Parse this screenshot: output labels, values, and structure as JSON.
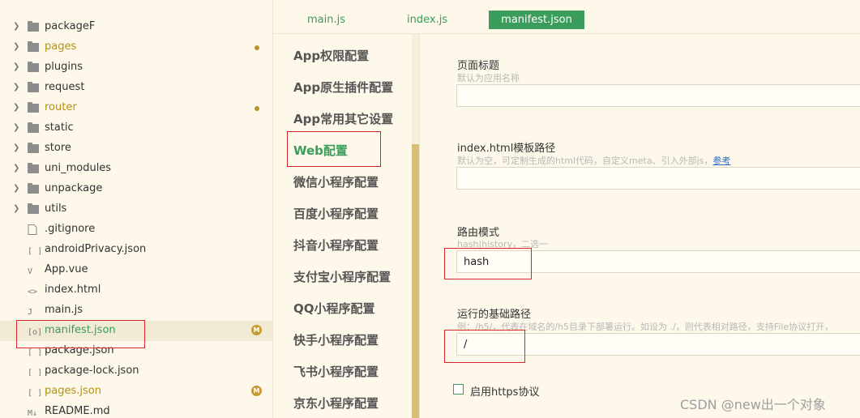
{
  "explorer": {
    "items": [
      {
        "label": "packageF",
        "kind": "folder",
        "status": ""
      },
      {
        "label": "pages",
        "kind": "folder",
        "status": "modified"
      },
      {
        "label": "plugins",
        "kind": "folder",
        "status": ""
      },
      {
        "label": "request",
        "kind": "folder",
        "status": ""
      },
      {
        "label": "router",
        "kind": "folder",
        "status": "modified"
      },
      {
        "label": "static",
        "kind": "folder",
        "status": ""
      },
      {
        "label": "store",
        "kind": "folder",
        "status": ""
      },
      {
        "label": "uni_modules",
        "kind": "folder",
        "status": ""
      },
      {
        "label": "unpackage",
        "kind": "folder",
        "status": ""
      },
      {
        "label": "utils",
        "kind": "folder",
        "status": ""
      },
      {
        "label": ".gitignore",
        "kind": "file",
        "glyph": "",
        "status": ""
      },
      {
        "label": "androidPrivacy.json",
        "kind": "file",
        "glyph": "[ ]",
        "status": ""
      },
      {
        "label": "App.vue",
        "kind": "file",
        "glyph": "V",
        "status": ""
      },
      {
        "label": "index.html",
        "kind": "file",
        "glyph": "<>",
        "status": ""
      },
      {
        "label": "main.js",
        "kind": "file",
        "glyph": "J",
        "status": ""
      },
      {
        "label": "manifest.json",
        "kind": "file",
        "glyph": "[o]",
        "status": "M",
        "active": true
      },
      {
        "label": "package.json",
        "kind": "file",
        "glyph": "[ ]",
        "status": ""
      },
      {
        "label": "package-lock.json",
        "kind": "file",
        "glyph": "[ ]",
        "status": ""
      },
      {
        "label": "pages.json",
        "kind": "file",
        "glyph": "[ ]",
        "status": "M"
      },
      {
        "label": "README.md",
        "kind": "file",
        "glyph": "M↓",
        "status": ""
      }
    ],
    "badge_letter": "M"
  },
  "tabs": [
    {
      "label": "main.js",
      "active": false
    },
    {
      "label": "index.js",
      "active": false
    },
    {
      "label": "manifest.json",
      "active": true
    }
  ],
  "settings_nav": {
    "items": [
      {
        "label": "App权限配置",
        "active": false
      },
      {
        "label": "App原生插件配置",
        "active": false
      },
      {
        "label": "App常用其它设置",
        "active": false
      },
      {
        "label": "Web配置",
        "active": true
      },
      {
        "label": "微信小程序配置",
        "active": false
      },
      {
        "label": "百度小程序配置",
        "active": false
      },
      {
        "label": "抖音小程序配置",
        "active": false
      },
      {
        "label": "支付宝小程序配置",
        "active": false
      },
      {
        "label": "QQ小程序配置",
        "active": false
      },
      {
        "label": "快手小程序配置",
        "active": false
      },
      {
        "label": "飞书小程序配置",
        "active": false
      },
      {
        "label": "京东小程序配置",
        "active": false
      }
    ]
  },
  "form": {
    "page_title": {
      "label": "页面标题",
      "hint": "默认为应用名称",
      "value": ""
    },
    "template_path": {
      "label": "index.html模板路径",
      "hint": "默认为空，可定制生成的html代码，自定义meta、引入外部js，",
      "link": "参考",
      "value": ""
    },
    "router_mode": {
      "label": "路由模式",
      "hint": "hash|history，二选一",
      "value": "hash"
    },
    "base_path": {
      "label": "运行的基础路径",
      "hint": "例：/h5/，代表在域名的/h5目录下部署运行。如设为 ./，则代表相对路径，支持File协议打开，",
      "value": "/"
    },
    "https": {
      "label": "启用https协议",
      "checked": false
    }
  },
  "watermark": "CSDN @new出一个对象",
  "colors": {
    "accent": "#3a9d5b",
    "highlight": "#d9262b",
    "modified": "#b59112",
    "background": "#fdf8ea"
  }
}
